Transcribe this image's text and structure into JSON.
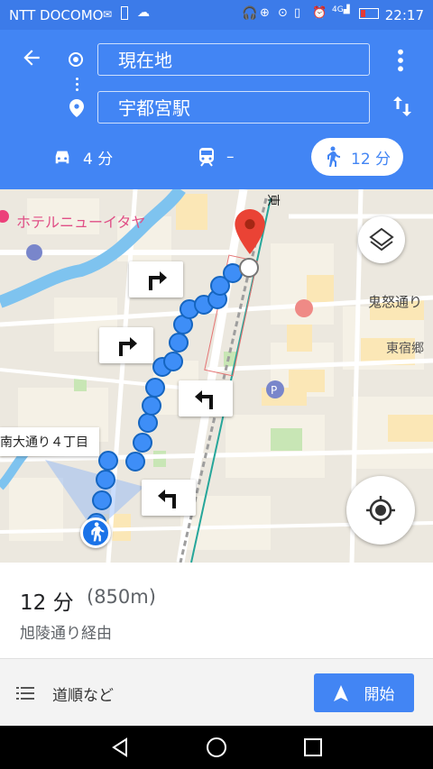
{
  "status": {
    "carrier": "NTT DOCOMO",
    "time": "22:17"
  },
  "route": {
    "origin": "現在地",
    "destination": "宇都宮駅",
    "modes": [
      {
        "name": "car",
        "label": "4 分",
        "icon": "car-icon"
      },
      {
        "name": "transit",
        "label": "–",
        "icon": "train-icon"
      },
      {
        "name": "walk",
        "label": "12 分",
        "icon": "walk-icon",
        "active": true
      }
    ]
  },
  "map": {
    "labels": {
      "hotel": "ホテルニューイタヤ",
      "road_east": "東",
      "kinu": "鬼怒通り",
      "higashijuku": "東宿郷",
      "street": "南大通り４丁目"
    },
    "colors": {
      "route": "#3e8ef7",
      "route_border": "#1565c0",
      "pin": "#ea4335"
    }
  },
  "summary": {
    "time": "12 分",
    "distance": "(850m)",
    "via": "旭陵通り経由"
  },
  "actions": {
    "steps": "道順など",
    "start": "開始"
  }
}
